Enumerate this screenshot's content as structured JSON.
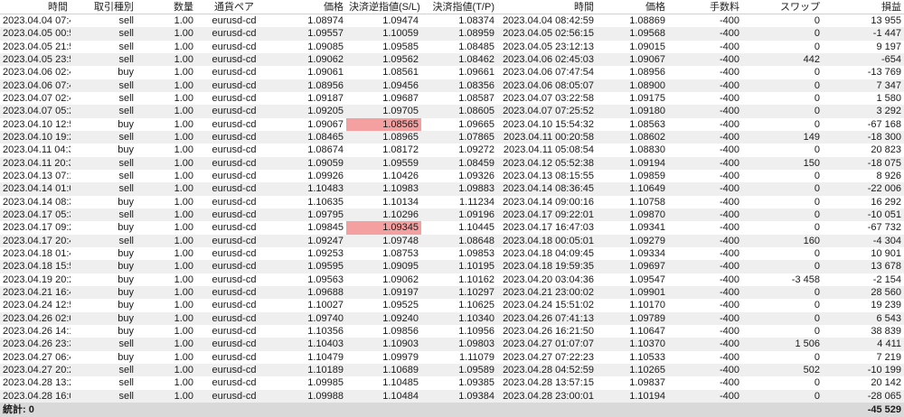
{
  "columns": [
    "時間",
    "取引種別",
    "数量",
    "通貨ペア",
    "価格",
    "決済逆指値(S/L)",
    "決済指値(T/P)",
    "時間",
    "価格",
    "手数料",
    "スワップ",
    "損益"
  ],
  "highlight_color": "#f5a0a0",
  "rows": [
    [
      "2023.04.04 07:46:57",
      "sell",
      "1.00",
      "eurusd-cd",
      "1.08974",
      "1.09474",
      "1.08374",
      "2023.04.04 08:42:59",
      "1.08869",
      "-400",
      "0",
      "13 955"
    ],
    [
      "2023.04.05 00:55:00",
      "sell",
      "1.00",
      "eurusd-cd",
      "1.09557",
      "1.10059",
      "1.08959",
      "2023.04.05 02:56:15",
      "1.09568",
      "-400",
      "0",
      "-1 447"
    ],
    [
      "2023.04.05 21:58:10",
      "sell",
      "1.00",
      "eurusd-cd",
      "1.09085",
      "1.09585",
      "1.08485",
      "2023.04.05 23:12:13",
      "1.09015",
      "-400",
      "0",
      "9 197"
    ],
    [
      "2023.04.05 23:51:32",
      "sell",
      "1.00",
      "eurusd-cd",
      "1.09062",
      "1.09562",
      "1.08462",
      "2023.04.06 02:45:03",
      "1.09067",
      "-400",
      "442",
      "-654"
    ],
    [
      "2023.04.06 02:46:29",
      "buy",
      "1.00",
      "eurusd-cd",
      "1.09061",
      "1.08561",
      "1.09661",
      "2023.04.06 07:47:54",
      "1.08956",
      "-400",
      "0",
      "-13 769"
    ],
    [
      "2023.04.06 07:47:55",
      "sell",
      "1.00",
      "eurusd-cd",
      "1.08956",
      "1.09456",
      "1.08356",
      "2023.04.06 08:05:07",
      "1.08900",
      "-400",
      "0",
      "7 347"
    ],
    [
      "2023.04.07 02:42:23",
      "sell",
      "1.00",
      "eurusd-cd",
      "1.09187",
      "1.09687",
      "1.08587",
      "2023.04.07 03:22:58",
      "1.09175",
      "-400",
      "0",
      "1 580"
    ],
    [
      "2023.04.07 05:24:43",
      "sell",
      "1.00",
      "eurusd-cd",
      "1.09205",
      "1.09705",
      "1.08605",
      "2023.04.07 07:25:52",
      "1.09180",
      "-400",
      "0",
      "3 292"
    ],
    [
      "2023.04.10 12:51:23",
      "buy",
      "1.00",
      "eurusd-cd",
      "1.09067",
      "1.08565",
      "1.09665",
      "2023.04.10 15:54:32",
      "1.08563",
      "-400",
      "0",
      "-67 168"
    ],
    [
      "2023.04.10 19:26:30",
      "sell",
      "1.00",
      "eurusd-cd",
      "1.08465",
      "1.08965",
      "1.07865",
      "2023.04.11 00:20:58",
      "1.08602",
      "-400",
      "149",
      "-18 300"
    ],
    [
      "2023.04.11 04:35:49",
      "buy",
      "1.00",
      "eurusd-cd",
      "1.08674",
      "1.08172",
      "1.09272",
      "2023.04.11 05:08:54",
      "1.08830",
      "-400",
      "0",
      "20 823"
    ],
    [
      "2023.04.11 20:39:07",
      "sell",
      "1.00",
      "eurusd-cd",
      "1.09059",
      "1.09559",
      "1.08459",
      "2023.04.12 05:52:38",
      "1.09194",
      "-400",
      "150",
      "-18 075"
    ],
    [
      "2023.04.13 07:15:38",
      "sell",
      "1.00",
      "eurusd-cd",
      "1.09926",
      "1.10426",
      "1.09326",
      "2023.04.13 08:15:55",
      "1.09859",
      "-400",
      "0",
      "8 926"
    ],
    [
      "2023.04.14 01:09:41",
      "sell",
      "1.00",
      "eurusd-cd",
      "1.10483",
      "1.10983",
      "1.09883",
      "2023.04.14 08:36:45",
      "1.10649",
      "-400",
      "0",
      "-22 006"
    ],
    [
      "2023.04.14 08:37:24",
      "buy",
      "1.00",
      "eurusd-cd",
      "1.10635",
      "1.10134",
      "1.11234",
      "2023.04.14 09:00:16",
      "1.10758",
      "-400",
      "0",
      "16 292"
    ],
    [
      "2023.04.17 05:38:02",
      "sell",
      "1.00",
      "eurusd-cd",
      "1.09795",
      "1.10296",
      "1.09196",
      "2023.04.17 09:22:01",
      "1.09870",
      "-400",
      "0",
      "-10 051"
    ],
    [
      "2023.04.17 09:23:45",
      "buy",
      "1.00",
      "eurusd-cd",
      "1.09845",
      "1.09345",
      "1.10445",
      "2023.04.17 16:47:03",
      "1.09341",
      "-400",
      "0",
      "-67 732"
    ],
    [
      "2023.04.17 20:40:19",
      "sell",
      "1.00",
      "eurusd-cd",
      "1.09247",
      "1.09748",
      "1.08648",
      "2023.04.18 00:05:01",
      "1.09279",
      "-400",
      "160",
      "-4 304"
    ],
    [
      "2023.04.18 01:48:23",
      "buy",
      "1.00",
      "eurusd-cd",
      "1.09253",
      "1.08753",
      "1.09853",
      "2023.04.18 04:09:45",
      "1.09334",
      "-400",
      "0",
      "10 901"
    ],
    [
      "2023.04.18 15:51:22",
      "buy",
      "1.00",
      "eurusd-cd",
      "1.09595",
      "1.09095",
      "1.10195",
      "2023.04.18 19:59:35",
      "1.09697",
      "-400",
      "0",
      "13 678"
    ],
    [
      "2023.04.19 20:27:35",
      "buy",
      "1.00",
      "eurusd-cd",
      "1.09563",
      "1.09062",
      "1.10162",
      "2023.04.20 03:04:36",
      "1.09547",
      "-400",
      "-3 458",
      "-2 154"
    ],
    [
      "2023.04.21 16:46:02",
      "buy",
      "1.00",
      "eurusd-cd",
      "1.09688",
      "1.09197",
      "1.10297",
      "2023.04.21 23:00:02",
      "1.09901",
      "-400",
      "0",
      "28 560"
    ],
    [
      "2023.04.24 12:59:01",
      "buy",
      "1.00",
      "eurusd-cd",
      "1.10027",
      "1.09525",
      "1.10625",
      "2023.04.24 15:51:02",
      "1.10170",
      "-400",
      "0",
      "19 239"
    ],
    [
      "2023.04.26 02:04:02",
      "buy",
      "1.00",
      "eurusd-cd",
      "1.09740",
      "1.09240",
      "1.10340",
      "2023.04.26 07:41:13",
      "1.09789",
      "-400",
      "0",
      "6 543"
    ],
    [
      "2023.04.26 14:12:30",
      "buy",
      "1.00",
      "eurusd-cd",
      "1.10356",
      "1.09856",
      "1.10956",
      "2023.04.26 16:21:50",
      "1.10647",
      "-400",
      "0",
      "38 839"
    ],
    [
      "2023.04.26 23:33:26",
      "sell",
      "1.00",
      "eurusd-cd",
      "1.10403",
      "1.10903",
      "1.09803",
      "2023.04.27 01:07:07",
      "1.10370",
      "-400",
      "1 506",
      "4 411"
    ],
    [
      "2023.04.27 06:47:16",
      "buy",
      "1.00",
      "eurusd-cd",
      "1.10479",
      "1.09979",
      "1.11079",
      "2023.04.27 07:22:23",
      "1.10533",
      "-400",
      "0",
      "7 219"
    ],
    [
      "2023.04.27 20:25:32",
      "sell",
      "1.00",
      "eurusd-cd",
      "1.10189",
      "1.10689",
      "1.09589",
      "2023.04.28 04:52:59",
      "1.10265",
      "-400",
      "502",
      "-10 199"
    ],
    [
      "2023.04.28 13:25:02",
      "sell",
      "1.00",
      "eurusd-cd",
      "1.09985",
      "1.10485",
      "1.09385",
      "2023.04.28 13:57:15",
      "1.09837",
      "-400",
      "0",
      "20 142"
    ],
    [
      "2023.04.28 16:03:15",
      "sell",
      "1.00",
      "eurusd-cd",
      "1.09988",
      "1.10484",
      "1.09384",
      "2023.04.28 23:00:01",
      "1.10194",
      "-400",
      "0",
      "-28 065"
    ]
  ],
  "highlighted_cells": [
    [
      8,
      5
    ],
    [
      16,
      5
    ]
  ],
  "footer": {
    "label": "統計: 0",
    "total": "-45 529"
  }
}
